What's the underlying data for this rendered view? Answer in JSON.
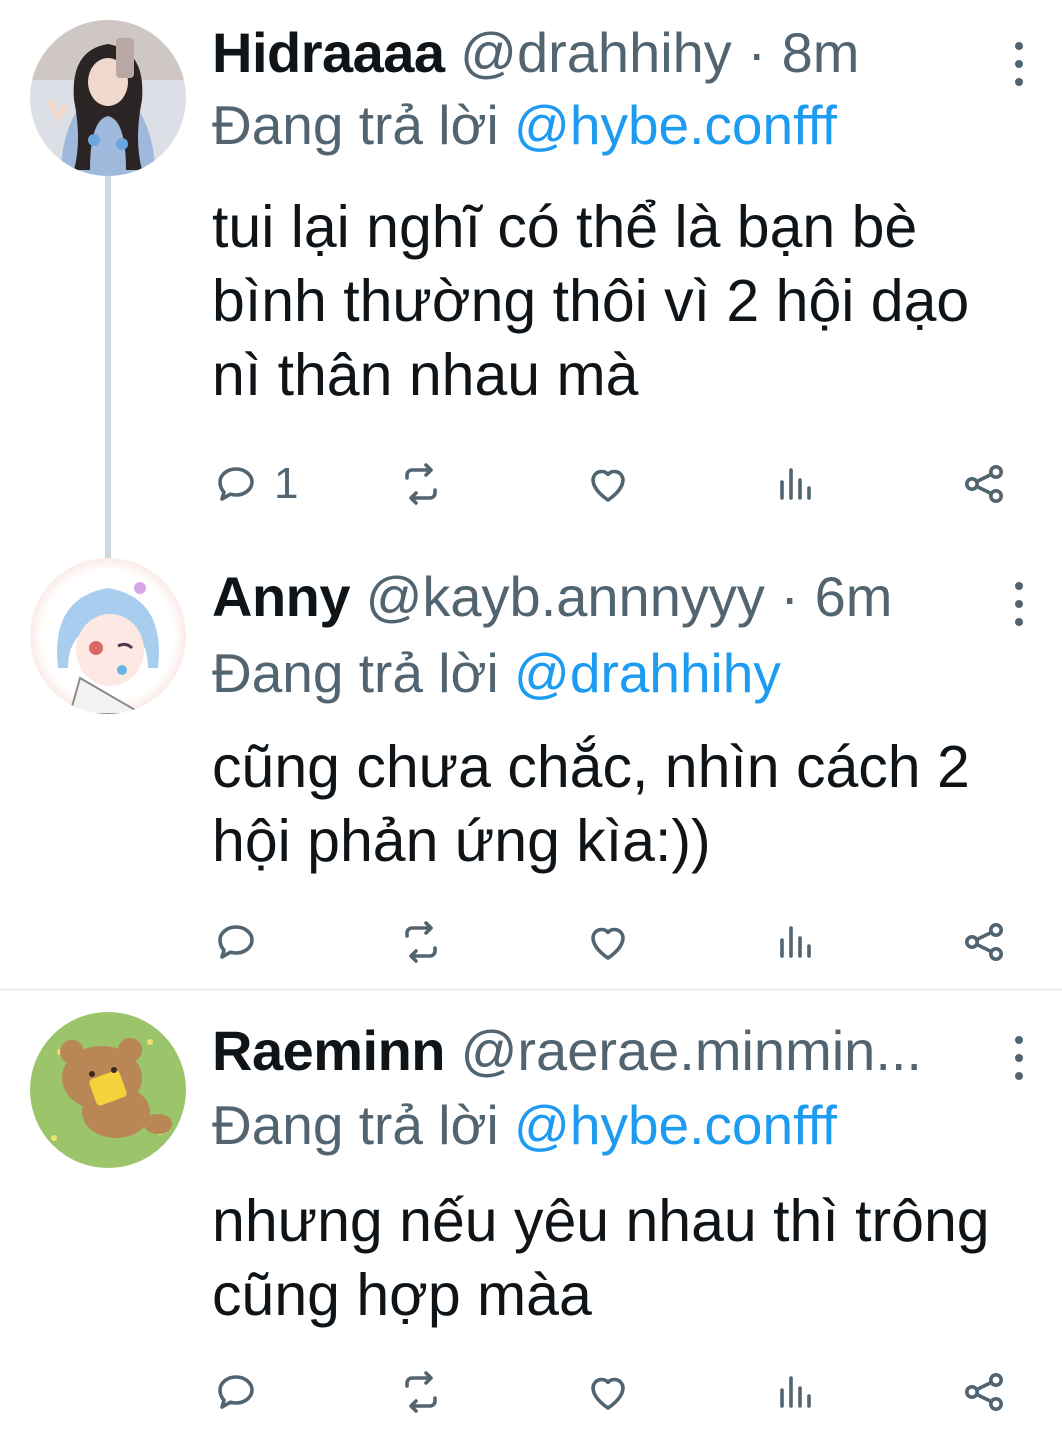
{
  "tweets": [
    {
      "name": "Hidraaaa",
      "handle": "@drahhihy",
      "separator": "·",
      "time": "8m",
      "replying_prefix": "Đang trả lời",
      "replying_to": "@hybe.confff",
      "lines": [
        "tui lại nghĩ có thể là bạn bè",
        "bình thường thôi vì 2 hội dạo",
        "nì thân nhau mà"
      ],
      "reply_count": "1"
    },
    {
      "name": "Anny",
      "handle": "@kayb.annnyyy",
      "separator": "·",
      "time": "6m",
      "replying_prefix": "Đang trả lời",
      "replying_to": "@drahhihy",
      "lines": [
        "cũng chưa chắc, nhìn cách 2",
        "hội phản ứng kìa:))"
      ],
      "reply_count": ""
    },
    {
      "name": "Raeminn",
      "handle": "@raerae.minmin...",
      "separator": "",
      "time": "",
      "replying_prefix": "Đang trả lời",
      "replying_to": "@hybe.confff",
      "lines": [
        "nhưng nếu yêu nhau thì trông",
        "cũng hợp màa"
      ],
      "reply_count": ""
    }
  ],
  "icons": {
    "reply": "reply-icon",
    "retweet": "retweet-icon",
    "like": "heart-icon",
    "views": "views-icon",
    "share": "share-icon",
    "more": "more-options-icon"
  },
  "colors": {
    "link": "#1d9bf0",
    "muted": "#536471",
    "text": "#0f1419"
  }
}
